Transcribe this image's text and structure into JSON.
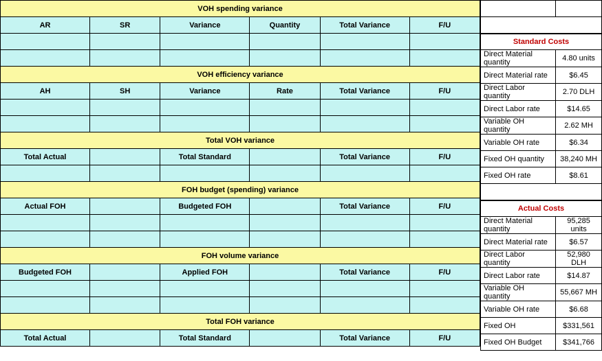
{
  "sections": {
    "voh_spending": {
      "title": "VOH spending variance",
      "headers": [
        "AR",
        "SR",
        "Variance",
        "Quantity",
        "Total Variance",
        "F/U"
      ]
    },
    "voh_efficiency": {
      "title": "VOH efficiency variance",
      "headers": [
        "AH",
        "SH",
        "Variance",
        "Rate",
        "Total Variance",
        "F/U"
      ]
    },
    "total_voh": {
      "title": "Total VOH variance",
      "headers": [
        "Total Actual",
        "",
        "Total Standard",
        "",
        "Total Variance",
        "F/U"
      ]
    },
    "foh_budget": {
      "title": "FOH budget (spending) variance",
      "headers": [
        "Actual FOH",
        "",
        "Budgeted FOH",
        "",
        "Total Variance",
        "F/U"
      ]
    },
    "foh_volume": {
      "title": "FOH volume variance",
      "headers": [
        "Budgeted FOH",
        "",
        "Applied FOH",
        "",
        "Total Variance",
        "F/U"
      ]
    },
    "total_foh": {
      "title": "Total FOH variance",
      "headers": [
        "Total Actual",
        "",
        "Total Standard",
        "",
        "Total Variance",
        "F/U"
      ]
    }
  },
  "standard_costs": {
    "title": "Standard Costs",
    "rows": [
      {
        "label": "Direct Material quantity",
        "value": "4.80 units"
      },
      {
        "label": "Direct Material rate",
        "value": "$6.45"
      },
      {
        "label": "Direct Labor quantity",
        "value": "2.70 DLH"
      },
      {
        "label": "Direct Labor rate",
        "value": "$14.65"
      },
      {
        "label": "Variable OH quantity",
        "value": "2.62 MH"
      },
      {
        "label": "Variable OH rate",
        "value": "$6.34"
      },
      {
        "label": "Fixed OH quantity",
        "value": "38,240 MH"
      },
      {
        "label": "Fixed OH rate",
        "value": "$8.61"
      }
    ]
  },
  "actual_costs": {
    "title": "Actual Costs",
    "rows": [
      {
        "label": "Direct Material quantity",
        "value": "95,285 units"
      },
      {
        "label": "Direct Material rate",
        "value": "$6.57"
      },
      {
        "label": "Direct Labor quantity",
        "value": "52,980 DLH"
      },
      {
        "label": "Direct Labor rate",
        "value": "$14.87"
      },
      {
        "label": "Variable OH quantity",
        "value": "55,667 MH"
      },
      {
        "label": "Variable OH rate",
        "value": "$6.68"
      },
      {
        "label": "Fixed OH",
        "value": "$331,561"
      },
      {
        "label": "Fixed OH Budget",
        "value": "$341,766"
      }
    ]
  }
}
